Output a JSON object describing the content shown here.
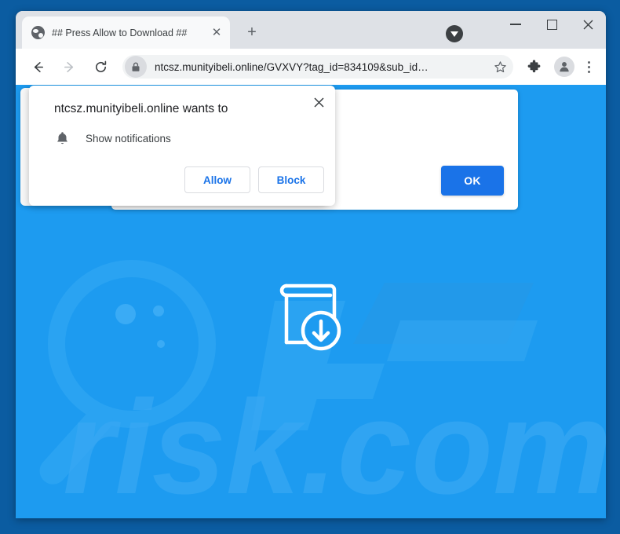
{
  "window": {
    "tab": {
      "title": "## Press Allow to Download ##",
      "favicon": "globe-icon",
      "close_label": "✕"
    },
    "new_tab_label": "+",
    "controls": {
      "download_indicator": "download-triangle-icon",
      "minimize_label": "—",
      "maximize_label": "□",
      "close_label": "✕"
    }
  },
  "toolbar": {
    "back_label": "←",
    "forward_label": "→",
    "reload_label": "⟳",
    "lock_icon": "lock-icon",
    "url": "ntcsz.munityibeli.online/GVXVY?tag_id=834109&sub_id…",
    "url_domain": "ntcsz.munityibeli.online",
    "url_path": "/GVXVY?tag_id=834109&sub_id…",
    "bookmark_label": "☆",
    "extensions_label": "puzzle-icon",
    "profile_label": "person-icon",
    "menu_label": "three-dot-menu-icon"
  },
  "permission_dialog": {
    "title": "ntcsz.munityibeli.online wants to",
    "close_label": "✕",
    "permission_icon": "bell-icon",
    "permission_label": "Show notifications",
    "allow_label": "Allow",
    "block_label": "Block"
  },
  "page": {
    "ok_label": "OK",
    "background_color": "#1d9bf0",
    "watermark_text": "pcrisk.com",
    "download_icon": "book-download-icon"
  },
  "colors": {
    "page_blue": "#1d9bf0",
    "frame_blue": "#0b5ca1",
    "accent_blue": "#1a73e8",
    "tabstrip_gray": "#dee1e6",
    "omnibox_gray": "#f1f3f4"
  }
}
